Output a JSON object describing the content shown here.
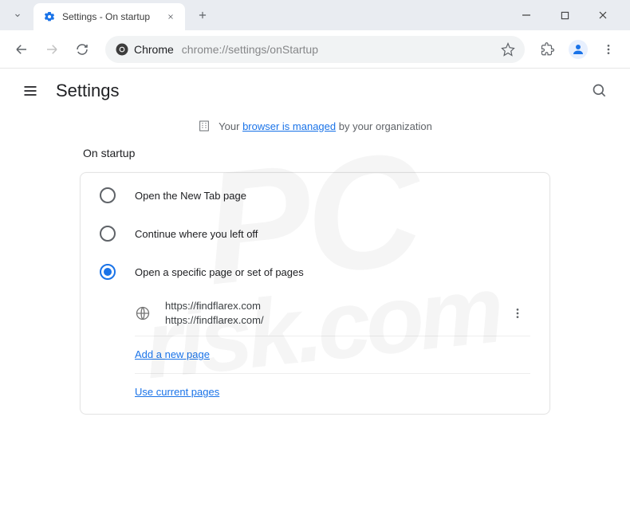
{
  "window": {
    "tab_title": "Settings - On startup"
  },
  "toolbar": {
    "site_label": "Chrome",
    "url": "chrome://settings/onStartup"
  },
  "header": {
    "title": "Settings"
  },
  "banner": {
    "prefix": "Your",
    "link": "browser is managed",
    "suffix": "by your organization"
  },
  "section": {
    "title": "On startup",
    "options": [
      {
        "label": "Open the New Tab page",
        "selected": false
      },
      {
        "label": "Continue where you left off",
        "selected": false
      },
      {
        "label": "Open a specific page or set of pages",
        "selected": true
      }
    ],
    "pages": [
      {
        "title": "https://findflarex.com",
        "url": "https://findflarex.com/"
      }
    ],
    "add_link": "Add a new page",
    "use_current_link": "Use current pages"
  },
  "watermark": {
    "line1": "PC",
    "line2": "risk.com"
  }
}
